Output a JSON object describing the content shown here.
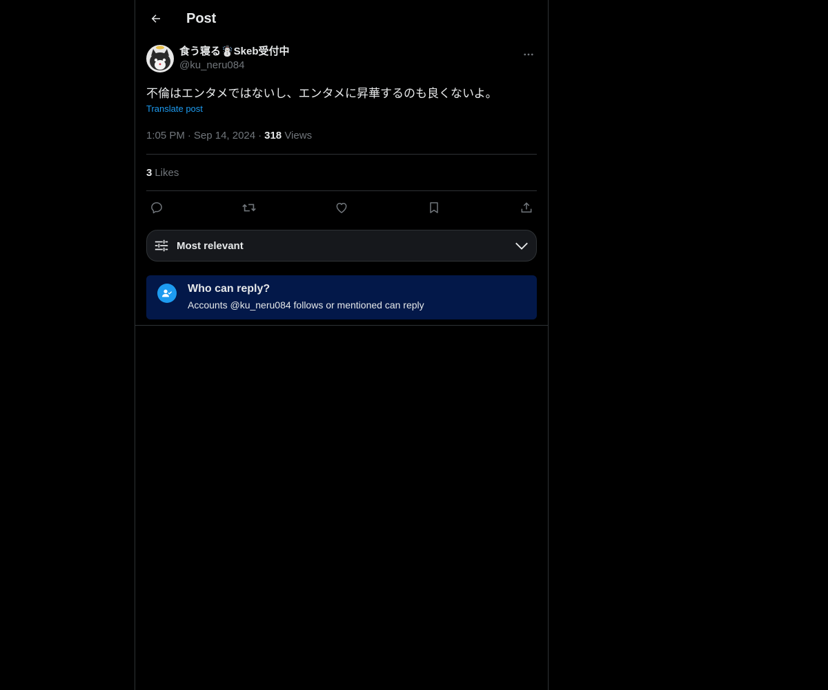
{
  "header": {
    "title": "Post"
  },
  "post": {
    "display_name": "食う寝る☃️Skeb受付中",
    "handle": "@ku_neru084",
    "text": "不倫はエンタメではないし、エンタメに昇華するのも良くないよ。",
    "translate_label": "Translate post",
    "time": "1:05 PM",
    "date": "Sep 14, 2024",
    "views_count": "318",
    "views_label": "Views",
    "likes_count": "3",
    "likes_label": "Likes"
  },
  "sort": {
    "label": "Most relevant"
  },
  "reply_restriction": {
    "title": "Who can reply?",
    "description": "Accounts @ku_neru084 follows or mentioned can reply"
  },
  "icons": {
    "back": "arrow-left-icon",
    "more": "more-horizontal-icon",
    "reply": "reply-bubble-icon",
    "repost": "repost-icon",
    "like": "heart-icon",
    "bookmark": "bookmark-icon",
    "share": "share-upload-icon",
    "sort": "sliders-icon",
    "chevron": "chevron-down-icon",
    "mention": "person-check-icon"
  },
  "colors": {
    "background": "#000000",
    "text": "#e7e9ea",
    "muted": "#71767b",
    "link": "#1d9bf0",
    "reply_box": "#031849",
    "border": "#2f3336"
  }
}
